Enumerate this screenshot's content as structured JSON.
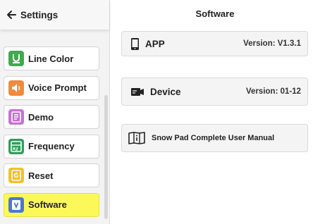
{
  "header": {
    "back_label": "Settings"
  },
  "menu": {
    "items": [
      {
        "label": "Line Color"
      },
      {
        "label": "Voice Prompt"
      },
      {
        "label": "Demo"
      },
      {
        "label": "Frequency"
      },
      {
        "label": "Reset"
      },
      {
        "label": "Software",
        "selected": true
      }
    ]
  },
  "main": {
    "title": "Software",
    "app": {
      "label": "APP",
      "version": "Version: V1.3.1"
    },
    "device": {
      "label": "Device",
      "version": "Version: 01-12"
    },
    "manual": {
      "label": "Snow Pad Complete User Manual"
    }
  },
  "colors": {
    "selected_item": "#fbf95a",
    "line_color_icon": "#3dac4c",
    "voice_prompt_icon": "#f08a3c",
    "demo_icon": "#c870d8",
    "frequency_icon": "#2fa05a",
    "reset_icon": "#f4c02a",
    "software_icon": "#4a78d6"
  }
}
